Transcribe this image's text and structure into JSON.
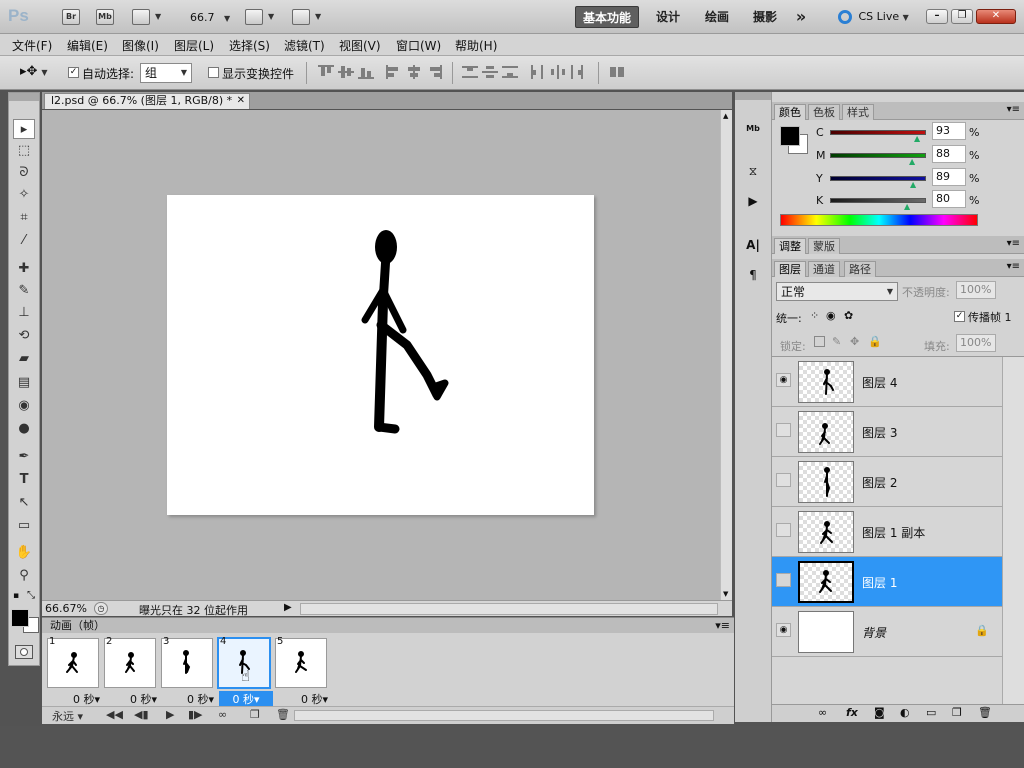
{
  "appbar": {
    "logo": "Ps",
    "br": "Br",
    "mb": "Mb",
    "zoom": "66.7",
    "workspaces": [
      "基本功能",
      "设计",
      "绘画",
      "摄影"
    ],
    "more": "»",
    "cslive": "CS Live"
  },
  "menubar": [
    "文件(F)",
    "编辑(E)",
    "图像(I)",
    "图层(L)",
    "选择(S)",
    "滤镜(T)",
    "视图(V)",
    "窗口(W)",
    "帮助(H)"
  ],
  "options": {
    "auto_select_label": "自动选择:",
    "auto_select_value": "组",
    "show_transform_label": "显示变换控件"
  },
  "document": {
    "tab_title": "l2.psd @ 66.7% (图层 1, RGB/8) *"
  },
  "status": {
    "zoom": "66.67%",
    "message": "曝光只在 32 位起作用"
  },
  "animation": {
    "title": "动画（帧）",
    "frames": [
      {
        "num": "1",
        "time": "0 秒"
      },
      {
        "num": "2",
        "time": "0 秒"
      },
      {
        "num": "3",
        "time": "0 秒"
      },
      {
        "num": "4",
        "time": "0 秒"
      },
      {
        "num": "5",
        "time": "0 秒"
      }
    ],
    "loop": "永远"
  },
  "color_panel": {
    "tabs": [
      "颜色",
      "色板",
      "样式"
    ],
    "channels": [
      {
        "name": "C",
        "value": "93",
        "unit": "%"
      },
      {
        "name": "M",
        "value": "88",
        "unit": "%"
      },
      {
        "name": "Y",
        "value": "89",
        "unit": "%"
      },
      {
        "name": "K",
        "value": "80",
        "unit": "%"
      }
    ]
  },
  "adjust_tabs": [
    "调整",
    "蒙版"
  ],
  "layers_panel": {
    "tabs": [
      "图层",
      "通道",
      "路径"
    ],
    "blend_mode": "正常",
    "opacity_label": "不透明度:",
    "opacity_value": "100%",
    "unify_label": "统一:",
    "propagate_label": "传播帧 1",
    "lock_label": "锁定:",
    "fill_label": "填充:",
    "fill_value": "100%",
    "layers": [
      {
        "name": "图层 4",
        "visible": true
      },
      {
        "name": "图层 3",
        "visible": false
      },
      {
        "name": "图层 2",
        "visible": false
      },
      {
        "name": "图层 1 副本",
        "visible": false
      },
      {
        "name": "图层 1",
        "visible": false,
        "selected": true
      },
      {
        "name": "背景",
        "visible": true,
        "locked": true
      }
    ]
  }
}
